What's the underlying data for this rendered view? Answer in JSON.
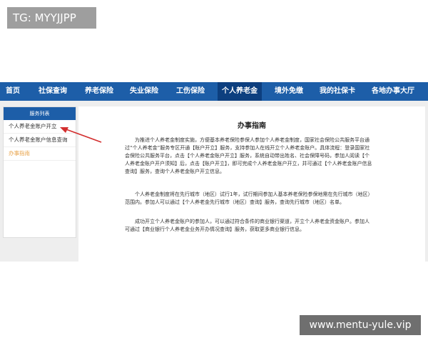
{
  "watermarks": {
    "top": "TG: MYYJJPP",
    "bottom": "www.mentu-yule.vip"
  },
  "nav": {
    "items": [
      {
        "label": "首页"
      },
      {
        "label": "社保查询"
      },
      {
        "label": "养老保险"
      },
      {
        "label": "失业保险"
      },
      {
        "label": "工伤保险"
      },
      {
        "label": "个人养老金",
        "active": true
      },
      {
        "label": "境外免缴"
      },
      {
        "label": "我的社保卡"
      },
      {
        "label": "各地办事大厅"
      }
    ]
  },
  "sidebar": {
    "header": "服务列表",
    "items": [
      {
        "label": "个人养老金账户开立"
      },
      {
        "label": "个人养老金账户信息查询"
      },
      {
        "label": "办事指南",
        "current": true
      }
    ]
  },
  "main": {
    "title": "办事指南",
    "paragraphs": [
      "为推进个人养老金制度实施，方便基本养老保险参保人参加个人养老金制度，国家社会保险公共服务平台通过“个人养老金”服务专区开通【账户开立】服务，支持参加人在线开立个人养老金账户。具体流程：登录国家社会保险公共服务平台，点击【个人养老金账户开立】服务，系统自动带出姓名、社会保障号码，参加人阅读【个人养老金账户开户须知】后，点击【账户开立】，即可完成个人养老金账户开立，并可通过【个人养老金账户信息查询】服务，查询个人养老金账户开立信息。",
      "个人养老金制度将在先行城市（地区）试行1年，试行期间参加人基本养老保险参保地需在先行城市（地区）范围内。参加人可以通过【个人养老金先行城市（地区）查询】服务，查询先行城市（地区）名单。",
      "成功开立个人养老金账户的参加人，可以通过符合条件的商业银行渠道，开立个人养老金资金账户。参加人可通过【商业银行个人养老金业务开办情况查询】服务，获取更多商业银行信息。"
    ]
  },
  "colors": {
    "nav_bg": "#1d5ea8",
    "nav_active": "#0d3f7f",
    "arrow": "#d32f2f",
    "current_link": "#e8a34a"
  }
}
